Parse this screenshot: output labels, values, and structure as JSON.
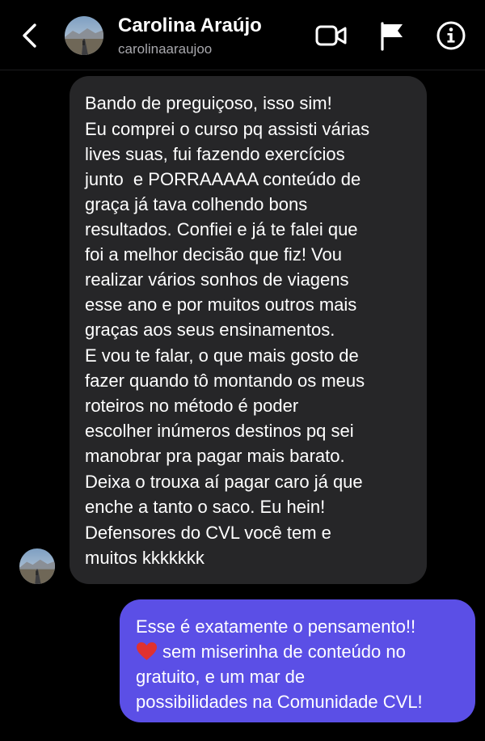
{
  "header": {
    "back_icon": "chevron-left-icon",
    "contact_name": "Carolina Araújo",
    "contact_username": "carolinaaraujoo",
    "video_icon": "video-camera-icon",
    "flag_icon": "flag-icon",
    "info_icon": "info-icon"
  },
  "messages": [
    {
      "direction": "received",
      "paragraphs": [
        {
          "lines": [
            "Bando de preguiçoso, isso sim!"
          ]
        },
        {
          "lines": [
            "Eu comprei o curso pq assisti várias",
            "lives suas, fui fazendo exercícios",
            "junto  e PORRAAAAA conteúdo de",
            "graça já tava colhendo bons",
            "resultados. Confiei e já te falei que",
            "foi a melhor decisão que fiz! Vou",
            "realizar vários sonhos de viagens",
            "esse ano e por muitos outros mais",
            "graças aos seus ensinamentos."
          ]
        },
        {
          "lines": [
            "E vou te falar, o que mais gosto de",
            "fazer quando tô montando os meus",
            "roteiros no método é poder",
            "escolher inúmeros destinos pq sei",
            "manobrar pra pagar mais barato."
          ]
        },
        {
          "lines": [
            "Deixa o trouxa aí pagar caro já que",
            "enche a tanto o saco. Eu hein!"
          ]
        },
        {
          "lines": [
            "Defensores do CVL você tem e",
            "muitos kkkkkkk"
          ]
        }
      ]
    },
    {
      "direction": "sent",
      "lines": [
        "Esse é exatamente o pensamento!!",
        "sem miserinha de conteúdo no",
        "gratuito, e um mar de",
        "possibilidades na Comunidade CVL!"
      ],
      "emoji": "red-heart-emoji"
    }
  ],
  "colors": {
    "background": "#000000",
    "received_bubble": "#262628",
    "sent_bubble": "#5b4fe6",
    "username_text": "#a8a8ad",
    "heart": "#e0312f"
  }
}
